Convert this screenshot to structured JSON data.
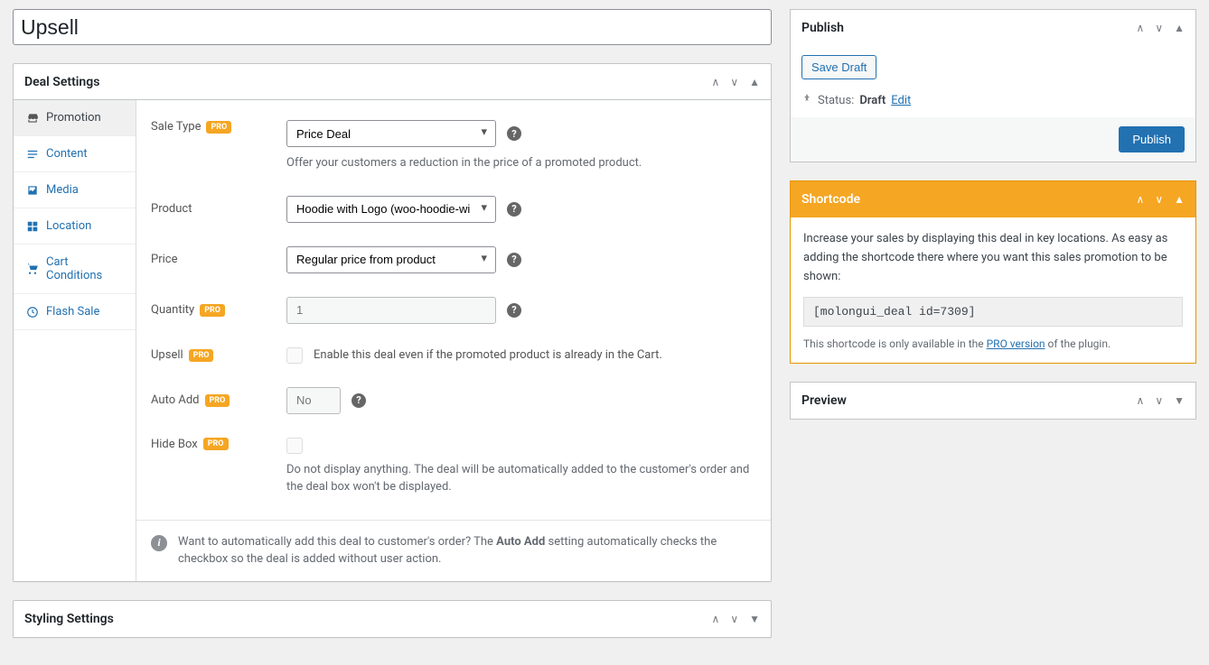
{
  "title": "Upsell",
  "dealSettings": {
    "header": "Deal Settings",
    "tabs": [
      {
        "key": "promotion",
        "label": "Promotion",
        "active": true
      },
      {
        "key": "content",
        "label": "Content"
      },
      {
        "key": "media",
        "label": "Media"
      },
      {
        "key": "location",
        "label": "Location"
      },
      {
        "key": "cart",
        "label": "Cart Conditions"
      },
      {
        "key": "flash",
        "label": "Flash Sale"
      }
    ],
    "fields": {
      "saleType": {
        "label": "Sale Type",
        "value": "Price Deal",
        "desc": "Offer your customers a reduction in the price of a promoted product."
      },
      "product": {
        "label": "Product",
        "value": "Hoodie with Logo (woo-hoodie-wit..."
      },
      "price": {
        "label": "Price",
        "value": "Regular price from product"
      },
      "quantity": {
        "label": "Quantity",
        "placeholder": "1"
      },
      "upsell": {
        "label": "Upsell",
        "desc": "Enable this deal even if the promoted product is already in the Cart."
      },
      "autoAdd": {
        "label": "Auto Add",
        "placeholder": "No"
      },
      "hideBox": {
        "label": "Hide Box",
        "desc": "Do not display anything. The deal will be automatically added to the customer's order and the deal box won't be displayed."
      }
    },
    "infoPrefix": "Want to automatically add this deal to customer's order? The ",
    "infoBold": "Auto Add",
    "infoSuffix": " setting automatically checks the checkbox so the deal is added without user action.",
    "proLabel": "PRO"
  },
  "stylingSettings": {
    "header": "Styling Settings"
  },
  "publish": {
    "header": "Publish",
    "saveDraft": "Save Draft",
    "statusLabel": "Status:",
    "statusValue": "Draft",
    "editLabel": "Edit",
    "publishBtn": "Publish"
  },
  "shortcode": {
    "header": "Shortcode",
    "desc": "Increase your sales by displaying this deal in key locations. As easy as adding the shortcode there where you want this sales promotion to be shown:",
    "code": "[molongui_deal id=7309]",
    "notePrefix": "This shortcode is only available in the ",
    "noteLink": "PRO version",
    "noteSuffix": " of the plugin."
  },
  "preview": {
    "header": "Preview"
  }
}
